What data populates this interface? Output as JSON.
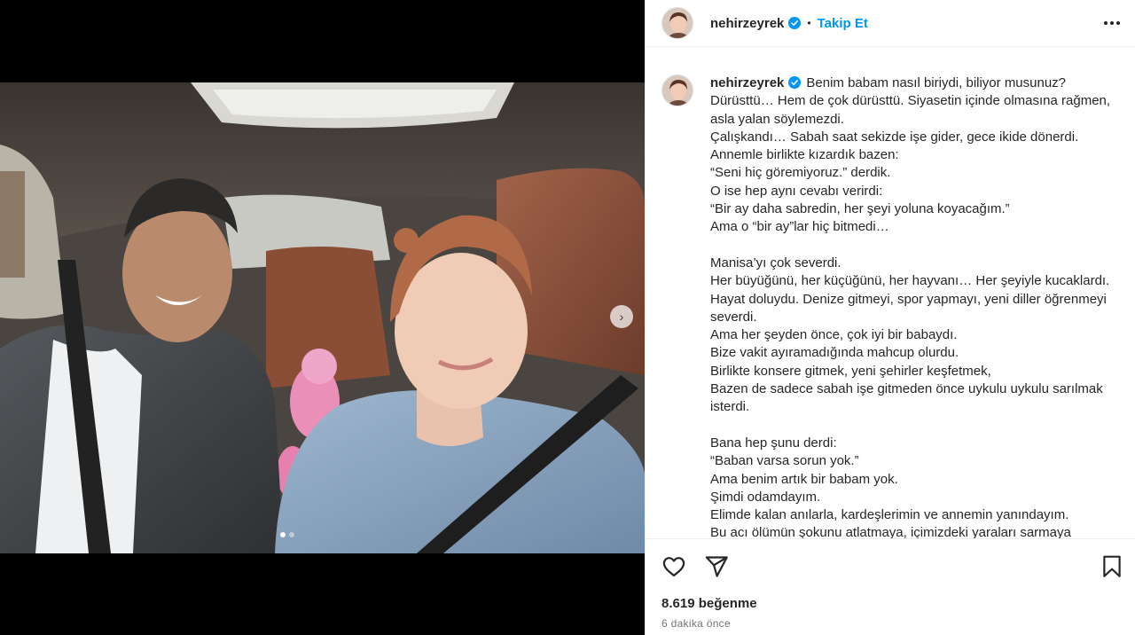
{
  "post": {
    "username": "nehirzeyrek",
    "follow_label": "Takip Et",
    "separator": "•",
    "likes": "8.619 beğenme",
    "timestamp": "6 dakika önce",
    "caption_lines": [
      "Benim babam nasıl biriydi, biliyor musunuz?",
      "Dürüsttü… Hem de çok dürüsttü. Siyasetin içinde olmasına rağmen,",
      "asla yalan söylemezdi.",
      "Çalışkandı… Sabah saat sekizde işe gider, gece ikide dönerdi.",
      "Annemle birlikte kızardık bazen:",
      "“Seni hiç göremiyoruz.” derdik.",
      "O ise hep aynı cevabı verirdi:",
      "“Bir ay daha sabredin, her şeyi yoluna koyacağım.”",
      "Ama o “bir ay”lar hiç bitmedi…",
      "",
      "Manisa’yı çok severdi.",
      "Her büyüğünü, her küçüğünü, her hayvanı… Her şeyiyle kucaklardı.",
      "Hayat doluydu. Denize gitmeyi, spor yapmayı, yeni diller öğrenmeyi",
      "severdi.",
      "Ama her şeyden önce, çok iyi bir babaydı.",
      "Bize vakit ayıramadığında mahcup olurdu.",
      "Birlikte konsere gitmek, yeni şehirler keşfetmek,",
      "Bazen de sadece sabah işe gitmeden önce uykulu uykulu sarılmak",
      "isterdi.",
      "",
      "Bana hep şunu derdi:",
      "“Baban varsa sorun yok.”",
      "Ama benim artık bir babam yok.",
      "Şimdi odamdayım.",
      "Elimde kalan anılarla, kardeşlerimin ve annemin yanındayım.",
      "Bu acı ölümün şokunu atlatmaya, içimizdeki yaraları sarmaya"
    ]
  },
  "icons": {
    "verified": "verified-badge-icon",
    "more": "more-options-icon",
    "like": "heart-icon",
    "share": "share-icon",
    "save": "bookmark-icon",
    "next": "chevron-right-icon"
  },
  "colors": {
    "accent": "#0095f6",
    "text": "#262626",
    "muted": "#737373",
    "verified": "#0095f6"
  },
  "carousel": {
    "next_glyph": "›",
    "slide_count": 2,
    "active_slide": 1
  }
}
